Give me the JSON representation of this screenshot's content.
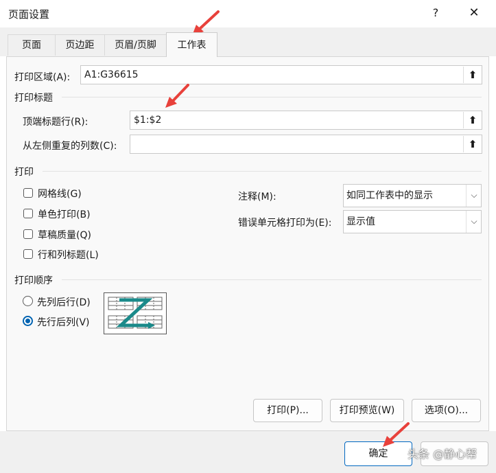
{
  "window": {
    "title": "页面设置",
    "help": "?",
    "close": "✕"
  },
  "tabs": [
    {
      "label": "页面",
      "active": false
    },
    {
      "label": "页边距",
      "active": false
    },
    {
      "label": "页眉/页脚",
      "active": false
    },
    {
      "label": "工作表",
      "active": true
    }
  ],
  "print_area": {
    "label": "打印区域(A):",
    "value": "A1:G36615"
  },
  "print_titles": {
    "heading": "打印标题",
    "rows_label": "顶端标题行(R):",
    "rows_value": "$1:$2",
    "cols_label": "从左侧重复的列数(C):",
    "cols_value": ""
  },
  "print": {
    "heading": "打印",
    "checkboxes": [
      {
        "label": "网格线(G)",
        "checked": false
      },
      {
        "label": "单色打印(B)",
        "checked": false
      },
      {
        "label": "草稿质量(Q)",
        "checked": false
      },
      {
        "label": "行和列标题(L)",
        "checked": false
      }
    ],
    "comments_label": "注释(M):",
    "comments_value": "如同工作表中的显示",
    "errors_label": "错误单元格打印为(E):",
    "errors_value": "显示值"
  },
  "page_order": {
    "heading": "打印顺序",
    "options": [
      {
        "label": "先列后行(D)",
        "selected": false
      },
      {
        "label": "先行后列(V)",
        "selected": true
      }
    ]
  },
  "buttons": {
    "print": "打印(P)...",
    "preview": "打印预览(W)",
    "options": "选项(O)...",
    "ok": "确定"
  },
  "watermark": "头条 @静心帮",
  "colors": {
    "accent": "#0063b1",
    "arrow": "#e8413b",
    "teal": "#1a8a8a"
  }
}
